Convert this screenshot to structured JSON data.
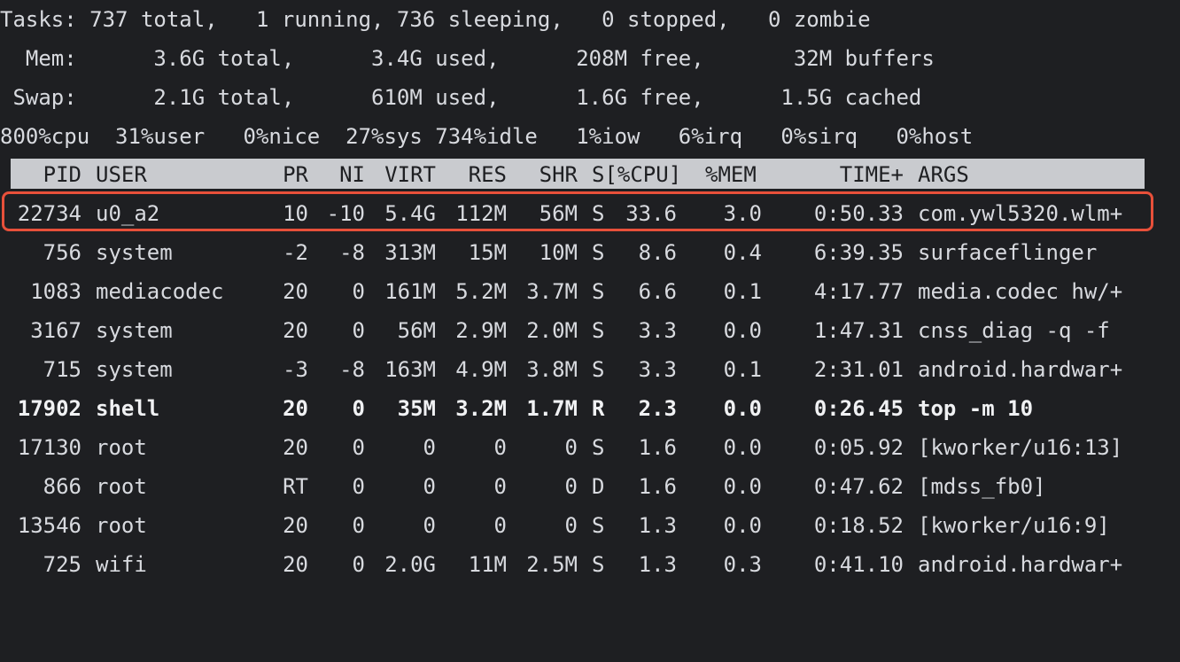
{
  "summary": {
    "tasks": "Tasks: 737 total,   1 running, 736 sleeping,   0 stopped,   0 zombie",
    "mem": "  Mem:      3.6G total,      3.4G used,      208M free,       32M buffers",
    "swap": " Swap:      2.1G total,      610M used,      1.6G free,      1.5G cached",
    "cpu": "800%cpu  31%user   0%nice  27%sys 734%idle   1%iow   6%irq   0%sirq   0%host"
  },
  "columns": {
    "pid": "PID",
    "user": "USER",
    "pr": "PR",
    "ni": "NI",
    "virt": "VIRT",
    "res": "RES",
    "shr": "SHR",
    "s": "S[%CPU]",
    "mem": "%MEM",
    "time": "TIME+",
    "args": "ARGS"
  },
  "highlight_color": "#e8503a",
  "processes": [
    {
      "pid": "22734",
      "user": "u0_a2",
      "pr": "10",
      "ni": "-10",
      "virt": "5.4G",
      "res": "112M",
      "shr": "56M",
      "s": "S",
      "cpu": "33.6",
      "mem": "3.0",
      "time": "0:50.33",
      "args": "com.ywl5320.wlm+"
    },
    {
      "pid": "756",
      "user": "system",
      "pr": "-2",
      "ni": "-8",
      "virt": "313M",
      "res": "15M",
      "shr": "10M",
      "s": "S",
      "cpu": "8.6",
      "mem": "0.4",
      "time": "6:39.35",
      "args": "surfaceflinger"
    },
    {
      "pid": "1083",
      "user": "mediacodec",
      "pr": "20",
      "ni": "0",
      "virt": "161M",
      "res": "5.2M",
      "shr": "3.7M",
      "s": "S",
      "cpu": "6.6",
      "mem": "0.1",
      "time": "4:17.77",
      "args": "media.codec hw/+"
    },
    {
      "pid": "3167",
      "user": "system",
      "pr": "20",
      "ni": "0",
      "virt": "56M",
      "res": "2.9M",
      "shr": "2.0M",
      "s": "S",
      "cpu": "3.3",
      "mem": "0.0",
      "time": "1:47.31",
      "args": "cnss_diag -q -f"
    },
    {
      "pid": "715",
      "user": "system",
      "pr": "-3",
      "ni": "-8",
      "virt": "163M",
      "res": "4.9M",
      "shr": "3.8M",
      "s": "S",
      "cpu": "3.3",
      "mem": "0.1",
      "time": "2:31.01",
      "args": "android.hardwar+"
    },
    {
      "pid": "17902",
      "user": "shell",
      "pr": "20",
      "ni": "0",
      "virt": "35M",
      "res": "3.2M",
      "shr": "1.7M",
      "s": "R",
      "cpu": "2.3",
      "mem": "0.0",
      "time": "0:26.45",
      "args": "top -m 10"
    },
    {
      "pid": "17130",
      "user": "root",
      "pr": "20",
      "ni": "0",
      "virt": "0",
      "res": "0",
      "shr": "0",
      "s": "S",
      "cpu": "1.6",
      "mem": "0.0",
      "time": "0:05.92",
      "args": "[kworker/u16:13]"
    },
    {
      "pid": "866",
      "user": "root",
      "pr": "RT",
      "ni": "0",
      "virt": "0",
      "res": "0",
      "shr": "0",
      "s": "D",
      "cpu": "1.6",
      "mem": "0.0",
      "time": "0:47.62",
      "args": "[mdss_fb0]"
    },
    {
      "pid": "13546",
      "user": "root",
      "pr": "20",
      "ni": "0",
      "virt": "0",
      "res": "0",
      "shr": "0",
      "s": "S",
      "cpu": "1.3",
      "mem": "0.0",
      "time": "0:18.52",
      "args": "[kworker/u16:9]"
    },
    {
      "pid": "725",
      "user": "wifi",
      "pr": "20",
      "ni": "0",
      "virt": "2.0G",
      "res": "11M",
      "shr": "2.5M",
      "s": "S",
      "cpu": "1.3",
      "mem": "0.3",
      "time": "0:41.10",
      "args": "android.hardwar+"
    }
  ]
}
